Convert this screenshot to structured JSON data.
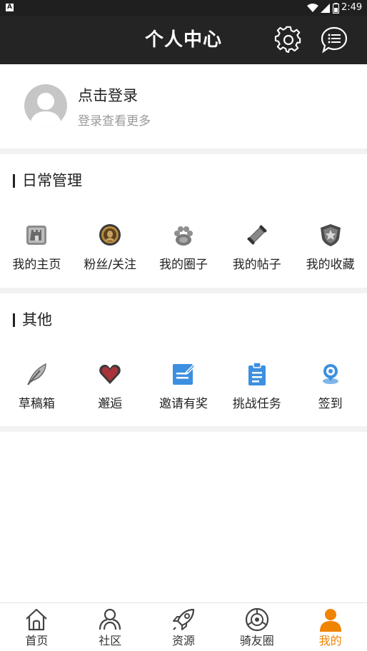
{
  "status_bar": {
    "app_icon": "A",
    "time": "2:49",
    "icons": [
      "wifi-icon",
      "signal-icon",
      "battery-icon"
    ]
  },
  "header": {
    "title": "个人中心",
    "icons": [
      "gear-icon",
      "chat-bubble-icon"
    ]
  },
  "login": {
    "title": "点击登录",
    "subtitle": "登录查看更多"
  },
  "daily": {
    "title": "日常管理",
    "items": [
      {
        "label": "我的主页",
        "icon": "castle-icon"
      },
      {
        "label": "粉丝/关注",
        "icon": "medallion-icon"
      },
      {
        "label": "我的圈子",
        "icon": "paw-icon"
      },
      {
        "label": "我的帖子",
        "icon": "scroll-icon"
      },
      {
        "label": "我的收藏",
        "icon": "star-shield-icon"
      }
    ]
  },
  "other": {
    "title": "其他",
    "items": [
      {
        "label": "草稿箱",
        "icon": "feather-icon"
      },
      {
        "label": "邂逅",
        "icon": "heart-icon"
      },
      {
        "label": "邀请有奖",
        "icon": "edit-note-icon"
      },
      {
        "label": "挑战任务",
        "icon": "clipboard-icon"
      },
      {
        "label": "签到",
        "icon": "location-pin-icon"
      }
    ]
  },
  "tabs": [
    {
      "label": "首页",
      "icon": "home-icon",
      "active": false
    },
    {
      "label": "社区",
      "icon": "community-icon",
      "active": false
    },
    {
      "label": "资源",
      "icon": "rocket-icon",
      "active": false
    },
    {
      "label": "骑友圈",
      "icon": "wheel-icon",
      "active": false
    },
    {
      "label": "我的",
      "icon": "person-icon",
      "active": true
    }
  ],
  "colors": {
    "header_bg": "#242424",
    "accent": "#f08300",
    "divider": "#f2f2f2",
    "icon_blue": "#3d8fe0"
  }
}
